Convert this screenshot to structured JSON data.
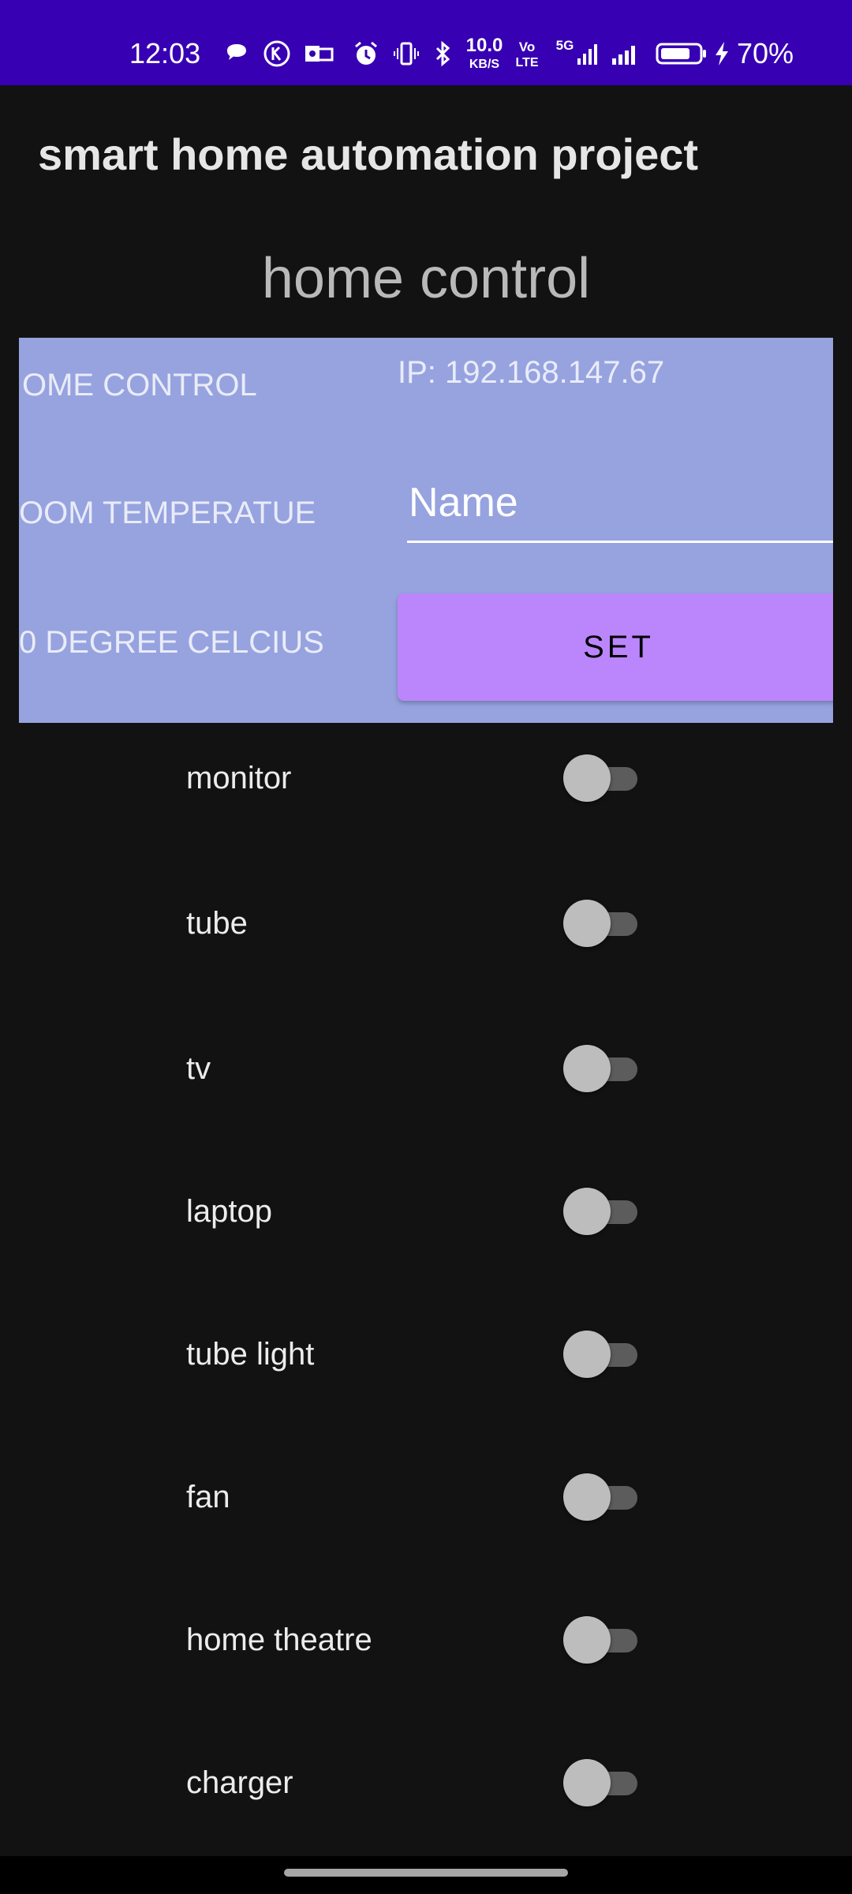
{
  "status_bar": {
    "time": "12:03",
    "net_speed_value": "10.0",
    "net_speed_unit": "KB/S",
    "volte_top": "Vo",
    "volte_bottom": "LTE",
    "network_type": "5G",
    "battery_percent": "70%",
    "icons": [
      "chat-bubble-icon",
      "k-app-icon",
      "outlook-icon",
      "alarm-icon",
      "vibrate-icon",
      "bluetooth-icon",
      "signal-icon",
      "signal-icon",
      "battery-icon",
      "charging-icon"
    ],
    "color": "#3700b3"
  },
  "app_bar": {
    "title": "smart home automation project"
  },
  "section_title": "home control",
  "panel": {
    "background": "#97a3df",
    "label_home_control": "OME CONTROL",
    "ip_text": "IP: 192.168.147.67",
    "label_room_temp": "OOM TEMPERATUE",
    "name_placeholder": "Name",
    "label_degree": "0 DEGREE CELCIUS",
    "set_label": "SET",
    "set_color": "#bb86fc"
  },
  "devices": [
    {
      "label": "monitor",
      "on": false
    },
    {
      "label": "tube",
      "on": false
    },
    {
      "label": "tv",
      "on": false
    },
    {
      "label": "laptop",
      "on": false
    },
    {
      "label": "tube light",
      "on": false
    },
    {
      "label": "fan",
      "on": false
    },
    {
      "label": "home theatre",
      "on": false
    },
    {
      "label": "charger",
      "on": false
    }
  ]
}
